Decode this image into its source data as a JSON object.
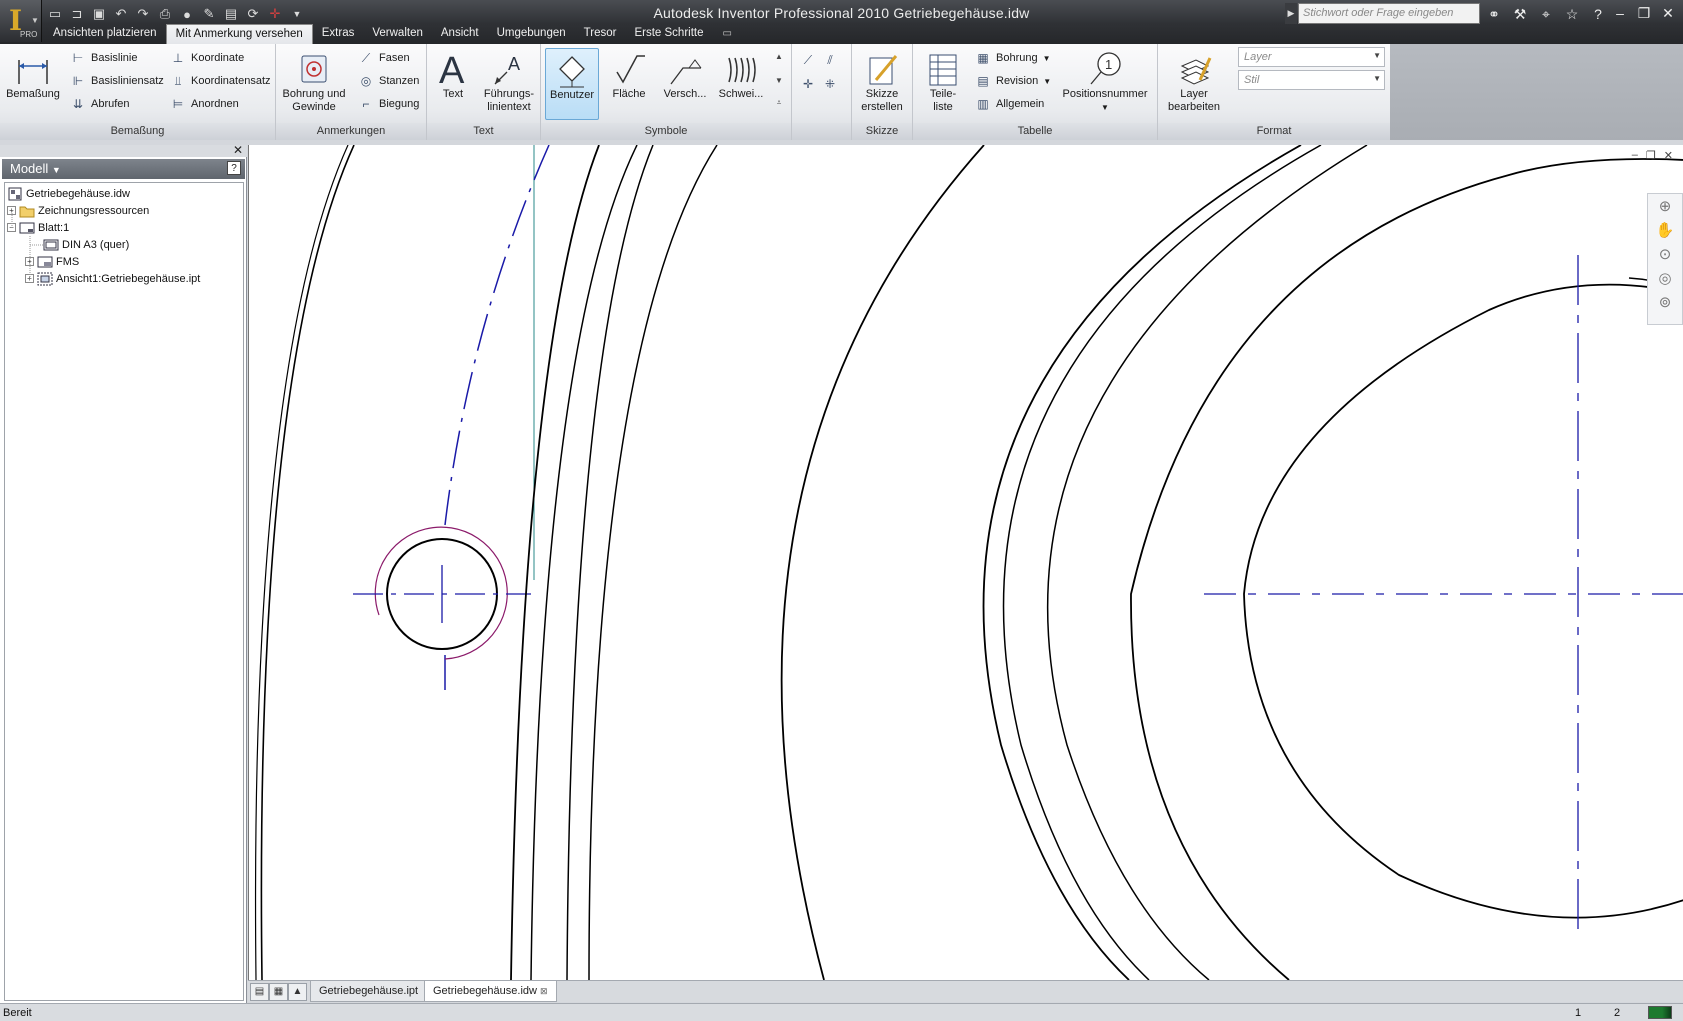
{
  "window": {
    "title": "Autodesk Inventor Professional 2010   Getriebegehäuse.idw",
    "logo_badge": "PRO",
    "search_placeholder": "Stichwort oder Frage eingeben"
  },
  "qat_icons": [
    "new-icon",
    "open-icon",
    "save-icon",
    "undo-icon",
    "redo-icon",
    "print-icon",
    "color-icon",
    "sketch-icon",
    "project-icon",
    "update-icon",
    "select-icon",
    "customize-icon"
  ],
  "tabs": [
    {
      "label": "Ansichten platzieren"
    },
    {
      "label": "Mit Anmerkung versehen",
      "active": true
    },
    {
      "label": "Extras"
    },
    {
      "label": "Verwalten"
    },
    {
      "label": "Ansicht"
    },
    {
      "label": "Umgebungen"
    },
    {
      "label": "Tresor"
    },
    {
      "label": "Erste Schritte"
    }
  ],
  "ribbon": {
    "bemassung": {
      "title": "Bemaßung",
      "big": "Bemaßung",
      "items": [
        "Basislinie",
        "Basisliniensatz",
        "Abrufen",
        "Koordinate",
        "Koordinatensatz",
        "Anordnen"
      ]
    },
    "anmerkungen": {
      "title": "Anmerkungen",
      "big_line1": "Bohrung und",
      "big_line2": "Gewinde",
      "items": [
        "Fasen",
        "Stanzen",
        "Biegung"
      ]
    },
    "text": {
      "title": "Text",
      "text_btn": "Text",
      "leader_line1": "Führungs-",
      "leader_line2": "linientext"
    },
    "symbole": {
      "title": "Symbole",
      "items": [
        "Benutzer",
        "Fläche",
        "Versch...",
        "Schwei..."
      ]
    },
    "skizze": {
      "title": "Skizze",
      "line1": "Skizze",
      "line2": "erstellen"
    },
    "tabelle": {
      "title": "Tabelle",
      "big_line1": "Teile-",
      "big_line2": "liste",
      "items": [
        "Bohrung",
        "Revision",
        "Allgemein"
      ],
      "posnum": "Positionsnummer",
      "posnum_glyph": "1"
    },
    "format": {
      "title": "Format",
      "layer_line1": "Layer",
      "layer_line2": "bearbeiten",
      "layer_combo": "Layer",
      "style_combo": "Stil"
    }
  },
  "browser": {
    "header": "Modell",
    "help": "?",
    "tree": [
      {
        "label": "Getriebegehäuse.idw",
        "level": 0
      },
      {
        "label": "Zeichnungsressourcen",
        "level": 0
      },
      {
        "label": "Blatt:1",
        "level": 0
      },
      {
        "label": "DIN A3 (quer)",
        "level": 1
      },
      {
        "label": "FMS",
        "level": 1
      },
      {
        "label": "Ansicht1:Getriebegehäuse.ipt",
        "level": 1
      }
    ]
  },
  "doc_tabs": [
    {
      "label": "Getriebegehäuse.ipt",
      "active": false
    },
    {
      "label": "Getriebegehäuse.idw",
      "active": true
    }
  ],
  "status": {
    "text": "Bereit",
    "n1": "1",
    "n2": "2"
  },
  "colors": {
    "centerline": "#1a1aa8",
    "highlight_arc": "#8b1a6a",
    "construction_line": "#2a8a8a",
    "geometry": "#000000",
    "ribbon_selected": "#b9ddf6"
  }
}
